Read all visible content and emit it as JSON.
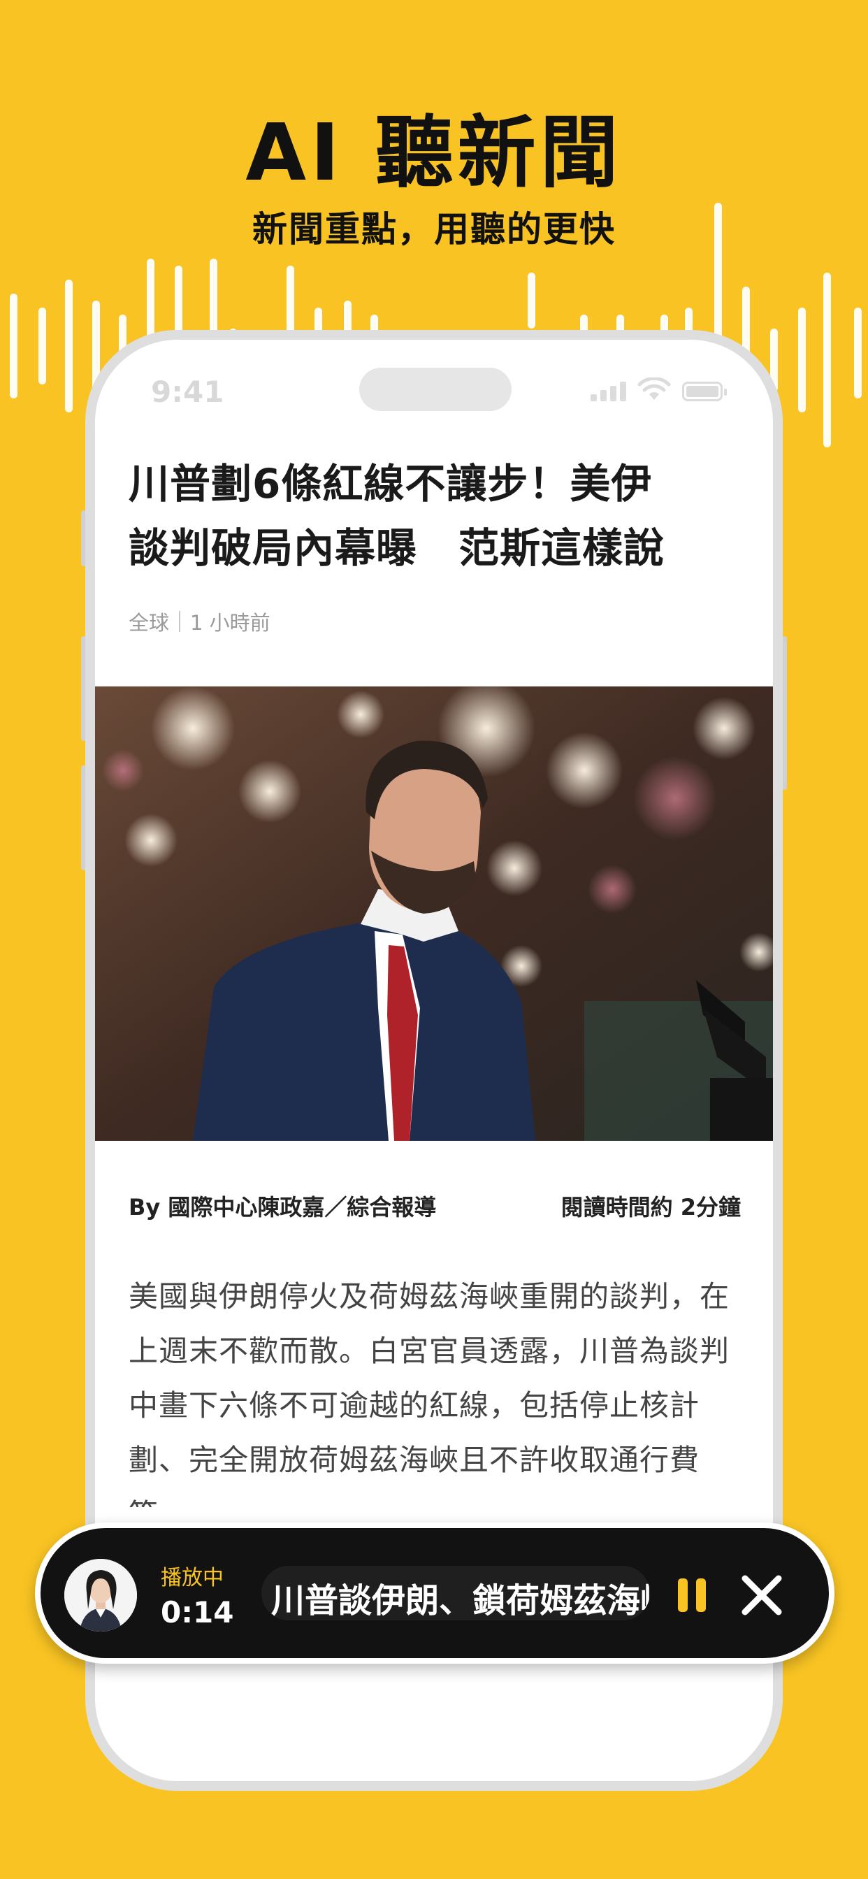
{
  "promo": {
    "headline": "AI 聽新聞",
    "subline": "新聞重點，用聽的更快"
  },
  "status_bar": {
    "time": "9:41"
  },
  "article": {
    "title": "川普劃6條紅線不讓步！美伊\n談判破局內幕曝　范斯這樣說",
    "category": "全球",
    "time_ago": "1 小時前",
    "byline": "By 國際中心陳政嘉／綜合報導",
    "read_time": "閱讀時間約 2分鐘",
    "body": "美國與伊朗停火及荷姆茲海峽重開的談判，在上週末不歡而散。白宮官員透露，川普為談判中畫下六條不可逾越的紅線，包括停止核計劃、完全開放荷姆茲海峽且不許收取通行費等。"
  },
  "player": {
    "status": "播放中",
    "elapsed": "0:14",
    "track_title": "川普談伊朗、鎖荷姆茲海峽",
    "accent": "#F9C423"
  }
}
